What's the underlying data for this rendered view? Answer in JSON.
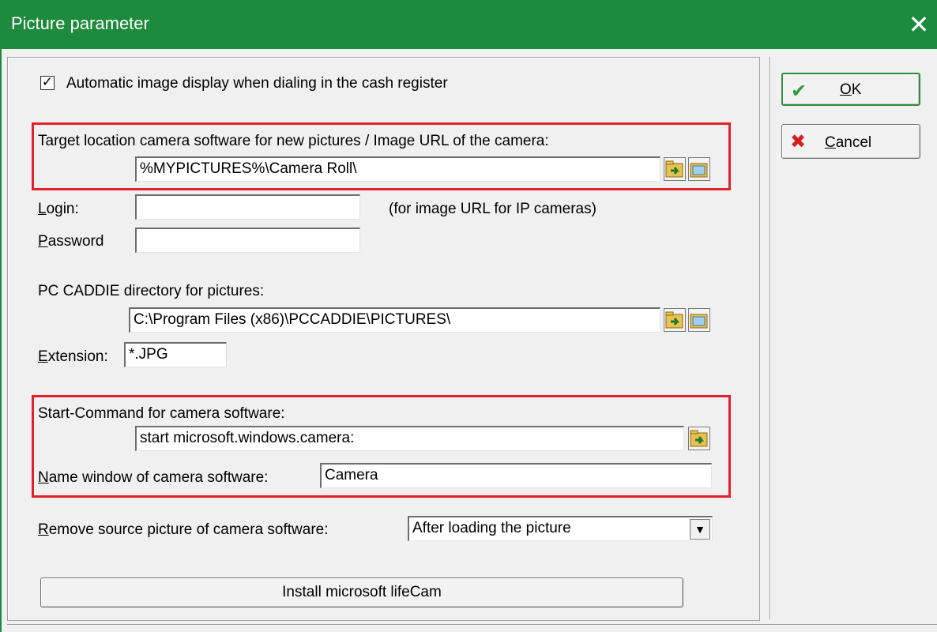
{
  "window": {
    "title": "Picture parameter",
    "close_glyph": "✕"
  },
  "auto_display": {
    "checked": true,
    "check_glyph": "✓",
    "label": "Automatic image display when dialing in the cash register"
  },
  "target_location": {
    "label": "Target location camera software for new pictures / Image URL of the camera:",
    "value": "%MYPICTURES%\\Camera Roll\\"
  },
  "login": {
    "label_u": "L",
    "label_rest": "ogin:",
    "value": "",
    "hint": "(for image URL for IP cameras)"
  },
  "password": {
    "label_u": "P",
    "label_rest": "assword",
    "value": ""
  },
  "pc_caddie": {
    "label": "PC CADDIE  directory for pictures:",
    "value": "C:\\Program Files (x86)\\PCCADDIE\\PICTURES\\"
  },
  "extension": {
    "label_u": "E",
    "label_rest": "xtension:",
    "value": "*.JPG"
  },
  "start_command": {
    "label": "Start-Command for camera software:",
    "value": "start microsoft.windows.camera:"
  },
  "window_name": {
    "label_u": "N",
    "label_rest": "ame window of camera software:",
    "value": "Camera"
  },
  "remove_source": {
    "label_u": "R",
    "label_rest": "emove source picture of camera software:",
    "value": "After loading the picture",
    "arrow": "▼"
  },
  "install_button": {
    "label": "Install microsoft lifeCam"
  },
  "ok_button": {
    "label_u": "O",
    "label_rest": "K",
    "icon": "check-icon",
    "icon_color": "#2e9b3e",
    "icon_glyph": "✔"
  },
  "cancel_button": {
    "label_u": "C",
    "label_rest": "ancel",
    "icon": "x-icon",
    "icon_color": "#d42020",
    "icon_glyph": "✖"
  },
  "colors": {
    "titlebar": "#1e8a3d",
    "highlight": "#e0202a"
  }
}
